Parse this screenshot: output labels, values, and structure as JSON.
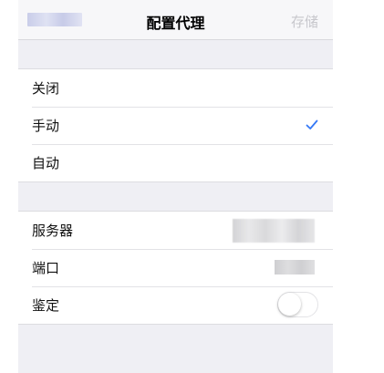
{
  "navbar": {
    "title": "配置代理",
    "save_label": "存储"
  },
  "proxy_modes": {
    "items": [
      {
        "label": "关闭"
      },
      {
        "label": "手动"
      },
      {
        "label": "自动"
      }
    ],
    "selected": "手动"
  },
  "settings": {
    "server_label": "服务器",
    "port_label": "端口",
    "auth_label": "鉴定",
    "auth_enabled": false
  },
  "colors": {
    "accent": "#3478f6",
    "background": "#efeff4",
    "disabled_text": "#c7c7cc"
  }
}
